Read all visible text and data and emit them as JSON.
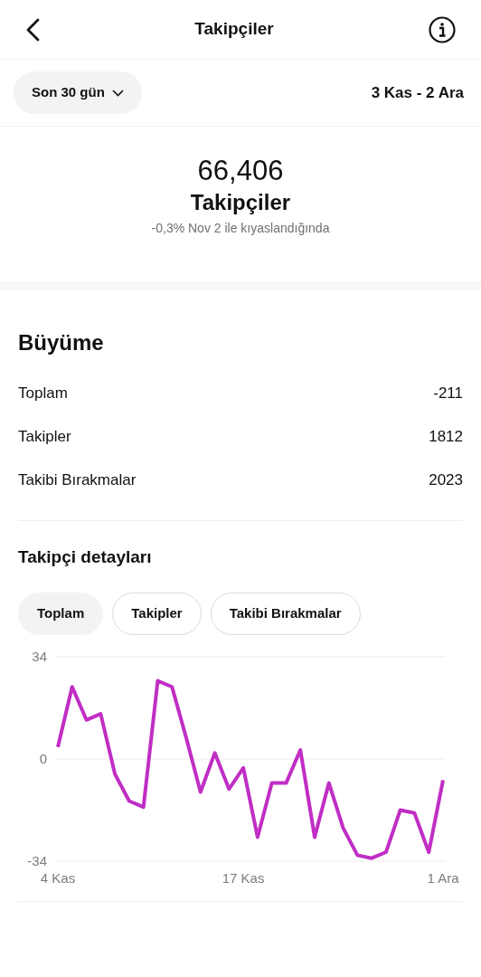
{
  "header": {
    "title": "Takipçiler"
  },
  "filter": {
    "period": "Son 30 gün",
    "range": "3 Kas - 2 Ara"
  },
  "summary": {
    "value": "66,406",
    "label": "Takipçiler",
    "comparison": "-0,3% Nov 2 ile kıyaslandığında"
  },
  "growth": {
    "title": "Büyüme",
    "rows": [
      {
        "label": "Toplam",
        "value": "-211"
      },
      {
        "label": "Takipler",
        "value": "1812"
      },
      {
        "label": "Takibi Bırakmalar",
        "value": "2023"
      }
    ]
  },
  "details": {
    "title": "Takipçi detayları",
    "tabs": [
      {
        "label": "Toplam",
        "selected": true
      },
      {
        "label": "Takipler",
        "selected": false
      },
      {
        "label": "Takibi Bırakmalar",
        "selected": false
      }
    ],
    "chart_data": {
      "type": "line",
      "categories": [
        "4 Kas",
        null,
        null,
        null,
        null,
        null,
        null,
        null,
        null,
        null,
        null,
        null,
        null,
        "17 Kas",
        null,
        null,
        null,
        null,
        null,
        null,
        null,
        null,
        null,
        null,
        null,
        null,
        null,
        "1 Ara"
      ],
      "series": [
        {
          "color": "#c02ec4",
          "values": [
            4,
            24,
            13,
            15,
            -5,
            -14,
            -16,
            26,
            24,
            7,
            -11,
            2,
            -10,
            -3,
            -26,
            -8,
            -8,
            3,
            -26,
            -8,
            -23,
            -32,
            -33,
            -31,
            -17,
            -18,
            -31,
            -7
          ]
        }
      ],
      "ylim": [
        -34,
        34
      ],
      "yticks": [
        -34,
        0,
        34
      ]
    }
  }
}
